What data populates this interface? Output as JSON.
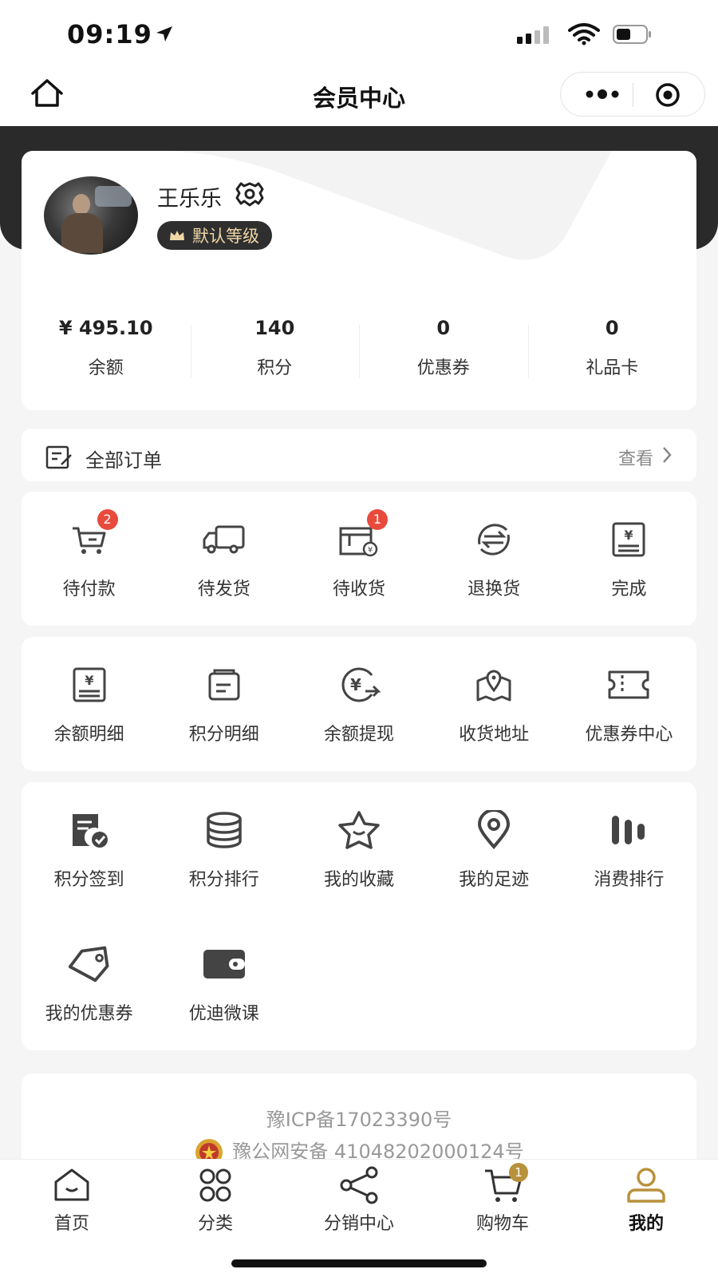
{
  "status_bar": {
    "time": "09:19"
  },
  "navbar": {
    "title": "会员中心"
  },
  "profile": {
    "name": "王乐乐",
    "level": "默认等级",
    "stats": [
      {
        "value": "¥ 495.10",
        "label": "余额"
      },
      {
        "value": "140",
        "label": "积分"
      },
      {
        "value": "0",
        "label": "优惠券"
      },
      {
        "value": "0",
        "label": "礼品卡"
      }
    ]
  },
  "orders": {
    "title": "全部订单",
    "view_label": "查看"
  },
  "order_status": [
    {
      "label": "待付款",
      "icon": "cart-icon",
      "badge": "2"
    },
    {
      "label": "待发货",
      "icon": "truck-icon"
    },
    {
      "label": "待收货",
      "icon": "package-icon",
      "badge": "1"
    },
    {
      "label": "退换货",
      "icon": "exchange-icon"
    },
    {
      "label": "完成",
      "icon": "receipt-icon"
    }
  ],
  "services": [
    {
      "label": "余额明细",
      "icon": "balance-detail-icon"
    },
    {
      "label": "积分明细",
      "icon": "points-detail-icon"
    },
    {
      "label": "余额提现",
      "icon": "withdraw-icon"
    },
    {
      "label": "收货地址",
      "icon": "map-pin-icon"
    },
    {
      "label": "优惠券中心",
      "icon": "ticket-icon"
    }
  ],
  "tools": [
    {
      "label": "积分签到",
      "icon": "checkin-icon"
    },
    {
      "label": "积分排行",
      "icon": "database-icon"
    },
    {
      "label": "我的收藏",
      "icon": "star-icon"
    },
    {
      "label": "我的足迹",
      "icon": "location-icon"
    },
    {
      "label": "消费排行",
      "icon": "bars-icon"
    },
    {
      "label": "我的优惠券",
      "icon": "tag-icon"
    },
    {
      "label": "优迪微课",
      "icon": "wallet-icon"
    }
  ],
  "footer": {
    "icp": "豫ICP备17023390号",
    "police": "豫公网安备 41048202000124号"
  },
  "tabbar": {
    "items": [
      {
        "label": "首页",
        "icon": "home-icon"
      },
      {
        "label": "分类",
        "icon": "category-icon"
      },
      {
        "label": "分销中心",
        "icon": "share-icon"
      },
      {
        "label": "购物车",
        "icon": "cart-icon",
        "badge": "1"
      },
      {
        "label": "我的",
        "icon": "user-icon",
        "active": true
      }
    ]
  },
  "colors": {
    "accent": "#b8913b",
    "badge_red": "#e84a3c",
    "dark": "#2a2a2a"
  }
}
